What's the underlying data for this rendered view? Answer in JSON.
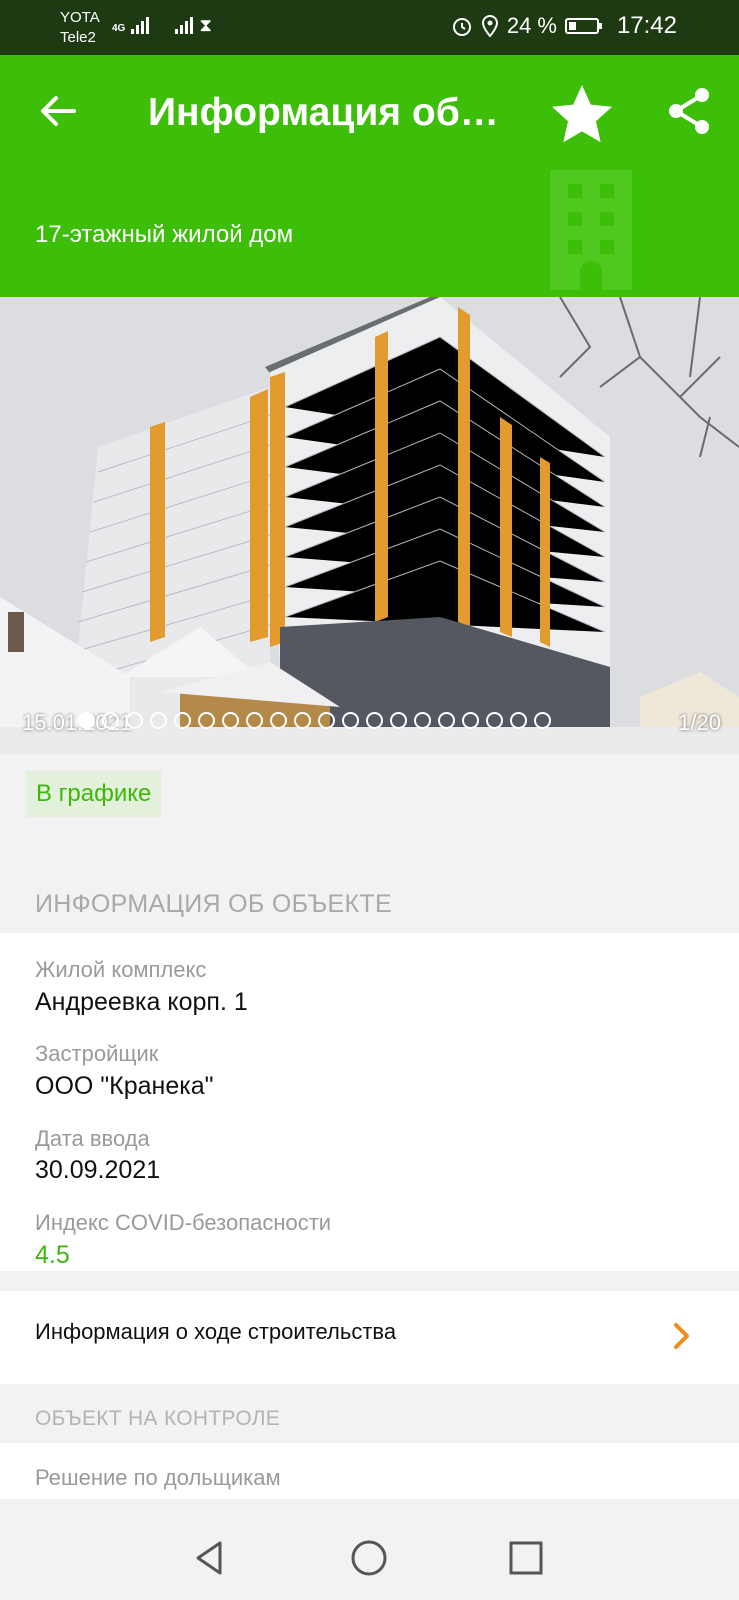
{
  "status_bar": {
    "carrier1": "YOTA",
    "carrier2": "Tele2",
    "network": "4G",
    "battery": "24 %",
    "time": "17:42"
  },
  "app_bar": {
    "title": "Информация об…",
    "subtitle": "17-этажный жилой дом",
    "icons": [
      "back-arrow-icon",
      "star-icon",
      "share-icon",
      "building-icon"
    ],
    "accent_color": "#3dbf0a"
  },
  "gallery": {
    "date": "15.01.2021",
    "counter": "1/20",
    "photo_index": 1,
    "photo_total": 20
  },
  "status_badge": "В графике",
  "section_object": {
    "header": "ИНФОРМАЦИЯ ОБ ОБЪЕКТЕ",
    "fields": [
      {
        "label": "Жилой комплекс",
        "value": "Андреевка корп. 1"
      },
      {
        "label": "Застройщик",
        "value": "ООО \"Кранека\""
      },
      {
        "label": "Дата ввода",
        "value": "30.09.2021"
      },
      {
        "label": "Индекс COVID-безопасности",
        "value": "4.5"
      }
    ]
  },
  "construction_progress_link": "Информация о ходе строительства",
  "section_control": {
    "header": "ОБЪЕКТ НА КОНТРОЛЕ",
    "item": "Решение по дольщикам"
  },
  "nav_bar": {
    "icons": [
      "back-triangle-icon",
      "home-circle-icon",
      "recents-square-icon"
    ]
  }
}
